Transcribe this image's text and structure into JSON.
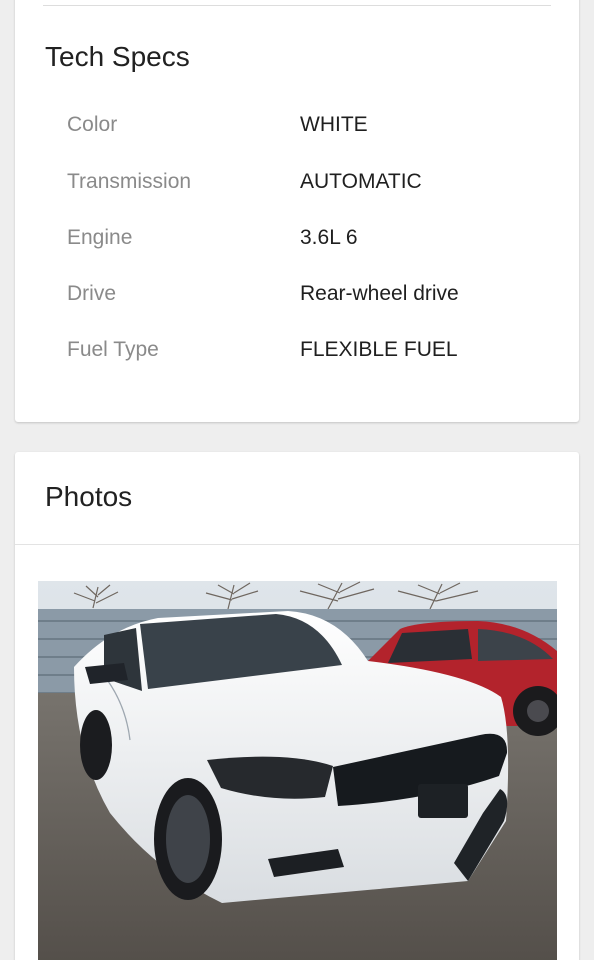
{
  "tech_specs": {
    "title": "Tech Specs",
    "rows": [
      {
        "label": "Color",
        "value": "WHITE"
      },
      {
        "label": "Transmission",
        "value": "AUTOMATIC"
      },
      {
        "label": "Engine",
        "value": "3.6L 6"
      },
      {
        "label": "Drive",
        "value": "Rear-wheel drive"
      },
      {
        "label": "Fuel Type",
        "value": "FLEXIBLE FUEL"
      }
    ]
  },
  "photos": {
    "title": "Photos",
    "main_photo": {
      "subject": "white-sedan-car-photo",
      "colors": {
        "car_body": "#f2f3f4",
        "background_car": "#b3232c",
        "ground": "#5f5a55",
        "fence": "#8a99a6"
      }
    }
  }
}
